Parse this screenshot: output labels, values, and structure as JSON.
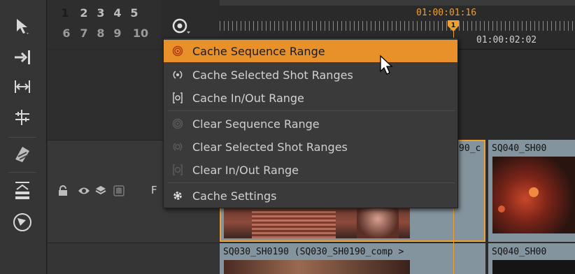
{
  "track_numbers": [
    "1",
    "2",
    "3",
    "4",
    "5",
    "6",
    "7",
    "8",
    "9",
    "10"
  ],
  "active_track": "1",
  "ruler": {
    "current_timecode": "01:00:01:16",
    "next_timecode": "01:00:02:02"
  },
  "menu": {
    "items": [
      {
        "label": "Cache Sequence Range",
        "icon": "cache-sequence-icon"
      },
      {
        "label": "Cache Selected Shot Ranges",
        "icon": "cache-selected-icon"
      },
      {
        "label": "Cache In/Out Range",
        "icon": "cache-inout-icon"
      },
      {
        "label": "Clear Sequence Range",
        "icon": "clear-sequence-icon"
      },
      {
        "label": "Clear Selected Shot Ranges",
        "icon": "clear-selected-icon"
      },
      {
        "label": "Clear In/Out Range",
        "icon": "clear-inout-icon"
      },
      {
        "label": "Cache Settings",
        "icon": "gear-icon"
      }
    ]
  },
  "track_header": {
    "label_initial": "F"
  },
  "clips": {
    "top_selected_label": "90_c",
    "top_right_label": "SQ040_SH00",
    "bottom_left_label": "SQ030_SH0190 (SQ030_SH0190_comp >",
    "bottom_right_label": "SQ040_SH00"
  },
  "colors": {
    "accent": "#f0a030",
    "menu_highlight": "#e8902a",
    "clip_bg": "#84949e"
  }
}
